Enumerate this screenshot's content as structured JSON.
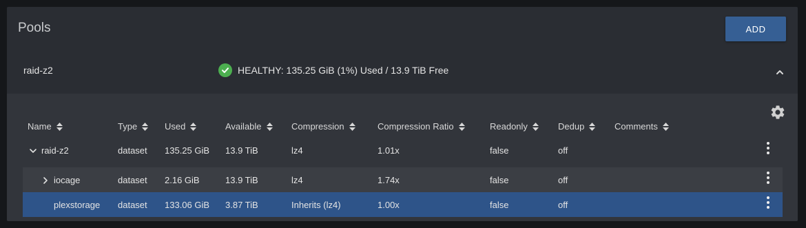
{
  "header": {
    "title": "Pools",
    "add_label": "ADD"
  },
  "pool": {
    "name": "raid-z2",
    "status_text": "HEALTHY: 135.25 GiB (1%) Used / 13.9 TiB Free",
    "status_color": "#4caf50"
  },
  "table": {
    "columns": [
      "Name",
      "Type",
      "Used",
      "Available",
      "Compression",
      "Compression Ratio",
      "Readonly",
      "Dedup",
      "Comments"
    ],
    "rows": [
      {
        "name": "raid-z2",
        "type": "dataset",
        "used": "135.25 GiB",
        "available": "13.9 TiB",
        "compression": "lz4",
        "ratio": "1.01x",
        "readonly": "false",
        "dedup": "off",
        "comments": ""
      },
      {
        "name": "iocage",
        "type": "dataset",
        "used": "2.16 GiB",
        "available": "13.9 TiB",
        "compression": "lz4",
        "ratio": "1.74x",
        "readonly": "false",
        "dedup": "off",
        "comments": ""
      },
      {
        "name": "plexstorage",
        "type": "dataset",
        "used": "133.06 GiB",
        "available": "3.87 TiB",
        "compression": "Inherits (lz4)",
        "ratio": "1.00x",
        "readonly": "false",
        "dedup": "off",
        "comments": ""
      }
    ]
  },
  "colors": {
    "accent": "#365f94",
    "selected_row": "#2e5489",
    "card_bg": "#2a2d33",
    "panel_bg": "#32353b"
  },
  "icons": {
    "status": "check-circle-icon",
    "collapse": "chevron-up-icon",
    "settings": "gear-icon",
    "sort": "sort-icon",
    "row_menu": "more-vert-icon"
  }
}
